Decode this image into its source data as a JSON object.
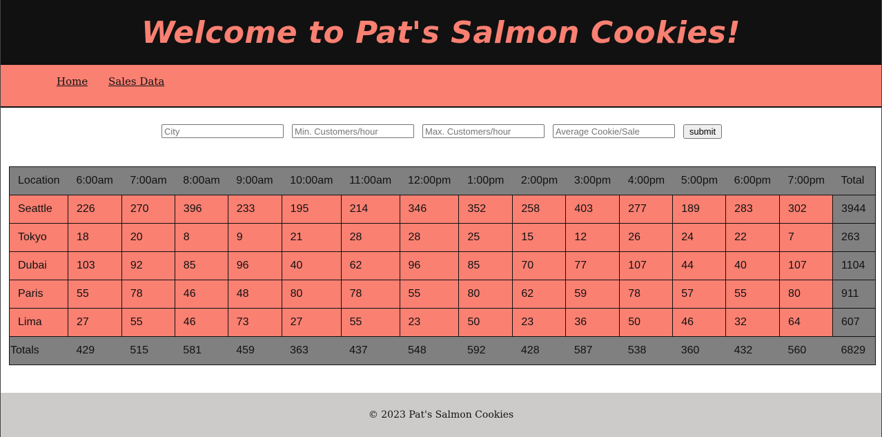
{
  "header": {
    "title": "Welcome to Pat's Salmon Cookies!"
  },
  "nav": {
    "home": "Home",
    "sales_data": "Sales Data"
  },
  "form": {
    "city_placeholder": "City",
    "min_placeholder": "Min. Customers/hour",
    "max_placeholder": "Max. Customers/hour",
    "avg_placeholder": "Average Cookie/Sale",
    "submit_label": "submit"
  },
  "table": {
    "headers": [
      "Location",
      "6:00am",
      "7:00am",
      "8:00am",
      "9:00am",
      "10:00am",
      "11:00am",
      "12:00pm",
      "1:00pm",
      "2:00pm",
      "3:00pm",
      "4:00pm",
      "5:00pm",
      "6:00pm",
      "7:00pm",
      "Total"
    ],
    "rows": [
      [
        "Seattle",
        "226",
        "270",
        "396",
        "233",
        "195",
        "214",
        "346",
        "352",
        "258",
        "403",
        "277",
        "189",
        "283",
        "302",
        "3944"
      ],
      [
        "Tokyo",
        "18",
        "20",
        "8",
        "9",
        "21",
        "28",
        "28",
        "25",
        "15",
        "12",
        "26",
        "24",
        "22",
        "7",
        "263"
      ],
      [
        "Dubai",
        "103",
        "92",
        "85",
        "96",
        "40",
        "62",
        "96",
        "85",
        "70",
        "77",
        "107",
        "44",
        "40",
        "107",
        "1104"
      ],
      [
        "Paris",
        "55",
        "78",
        "46",
        "48",
        "80",
        "78",
        "55",
        "80",
        "62",
        "59",
        "78",
        "57",
        "55",
        "80",
        "911"
      ],
      [
        "Lima",
        "27",
        "55",
        "46",
        "73",
        "27",
        "55",
        "23",
        "50",
        "23",
        "36",
        "50",
        "46",
        "32",
        "64",
        "607"
      ]
    ],
    "totals": [
      "Totals",
      "429",
      "515",
      "581",
      "459",
      "363",
      "437",
      "548",
      "592",
      "428",
      "587",
      "538",
      "360",
      "432",
      "560",
      "6829"
    ]
  },
  "colors": {
    "header_bg": "#111111",
    "accent_salmon": "#fa8072",
    "table_gray": "#808080",
    "footer_bg": "#cdcaca"
  },
  "footer": {
    "copyright": "© 2023 Pat's Salmon Cookies"
  }
}
